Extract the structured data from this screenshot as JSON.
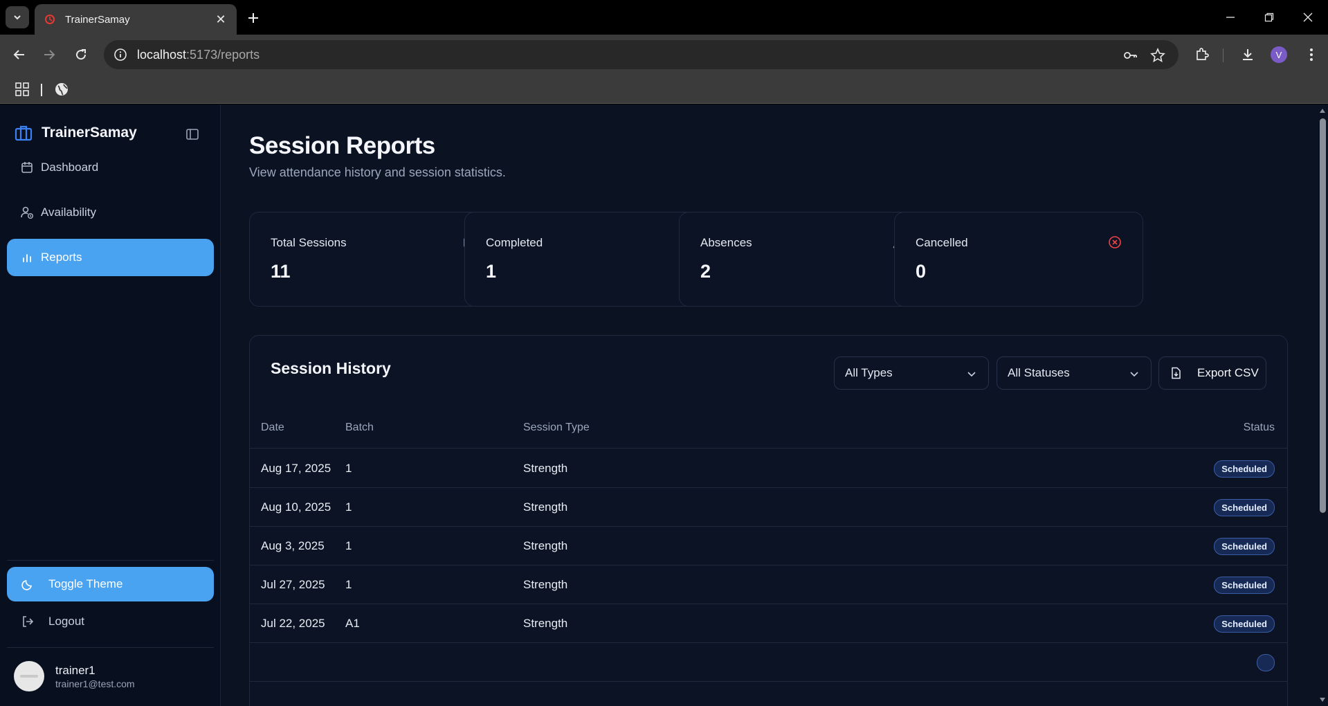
{
  "browser": {
    "tab_title": "TrainerSamay",
    "url_host": "localhost",
    "url_rest": ":5173/reports",
    "profile_initial": "V"
  },
  "sidebar": {
    "brand": "TrainerSamay",
    "items": [
      {
        "label": "Dashboard",
        "icon": "calendar-icon",
        "active": false
      },
      {
        "label": "Availability",
        "icon": "user-clock-icon",
        "active": false
      },
      {
        "label": "Reports",
        "icon": "bar-chart-icon",
        "active": true
      }
    ],
    "toggle_theme": "Toggle Theme",
    "logout": "Logout",
    "user": {
      "name": "trainer1",
      "email": "trainer1@test.com"
    }
  },
  "page": {
    "title": "Session Reports",
    "subtitle": "View attendance history and session statistics."
  },
  "stats": [
    {
      "label": "Total Sessions",
      "value": "11",
      "icon": "calendar-clock-icon",
      "color": "#9aa7bd"
    },
    {
      "label": "Completed",
      "value": "1",
      "icon": "check-circle-icon",
      "color": "#22c55e"
    },
    {
      "label": "Absences",
      "value": "2",
      "icon": "warning-icon",
      "color": "#f59e0b"
    },
    {
      "label": "Cancelled",
      "value": "0",
      "icon": "x-circle-icon",
      "color": "#ef4444"
    }
  ],
  "history": {
    "title": "Session History",
    "type_filter": "All Types",
    "status_filter": "All Statuses",
    "export_label": "Export CSV",
    "columns": [
      "Date",
      "Batch",
      "Session Type",
      "Status"
    ],
    "rows": [
      {
        "date": "Aug 17, 2025",
        "batch": "1",
        "type": "Strength",
        "status": "Scheduled"
      },
      {
        "date": "Aug 10, 2025",
        "batch": "1",
        "type": "Strength",
        "status": "Scheduled"
      },
      {
        "date": "Aug 3, 2025",
        "batch": "1",
        "type": "Strength",
        "status": "Scheduled"
      },
      {
        "date": "Jul 27, 2025",
        "batch": "1",
        "type": "Strength",
        "status": "Scheduled"
      },
      {
        "date": "Jul 22, 2025",
        "batch": "A1",
        "type": "Strength",
        "status": "Scheduled"
      }
    ]
  },
  "colors": {
    "accent": "#4aa3f0",
    "background": "#0b1222",
    "sidebar": "#08101f"
  }
}
